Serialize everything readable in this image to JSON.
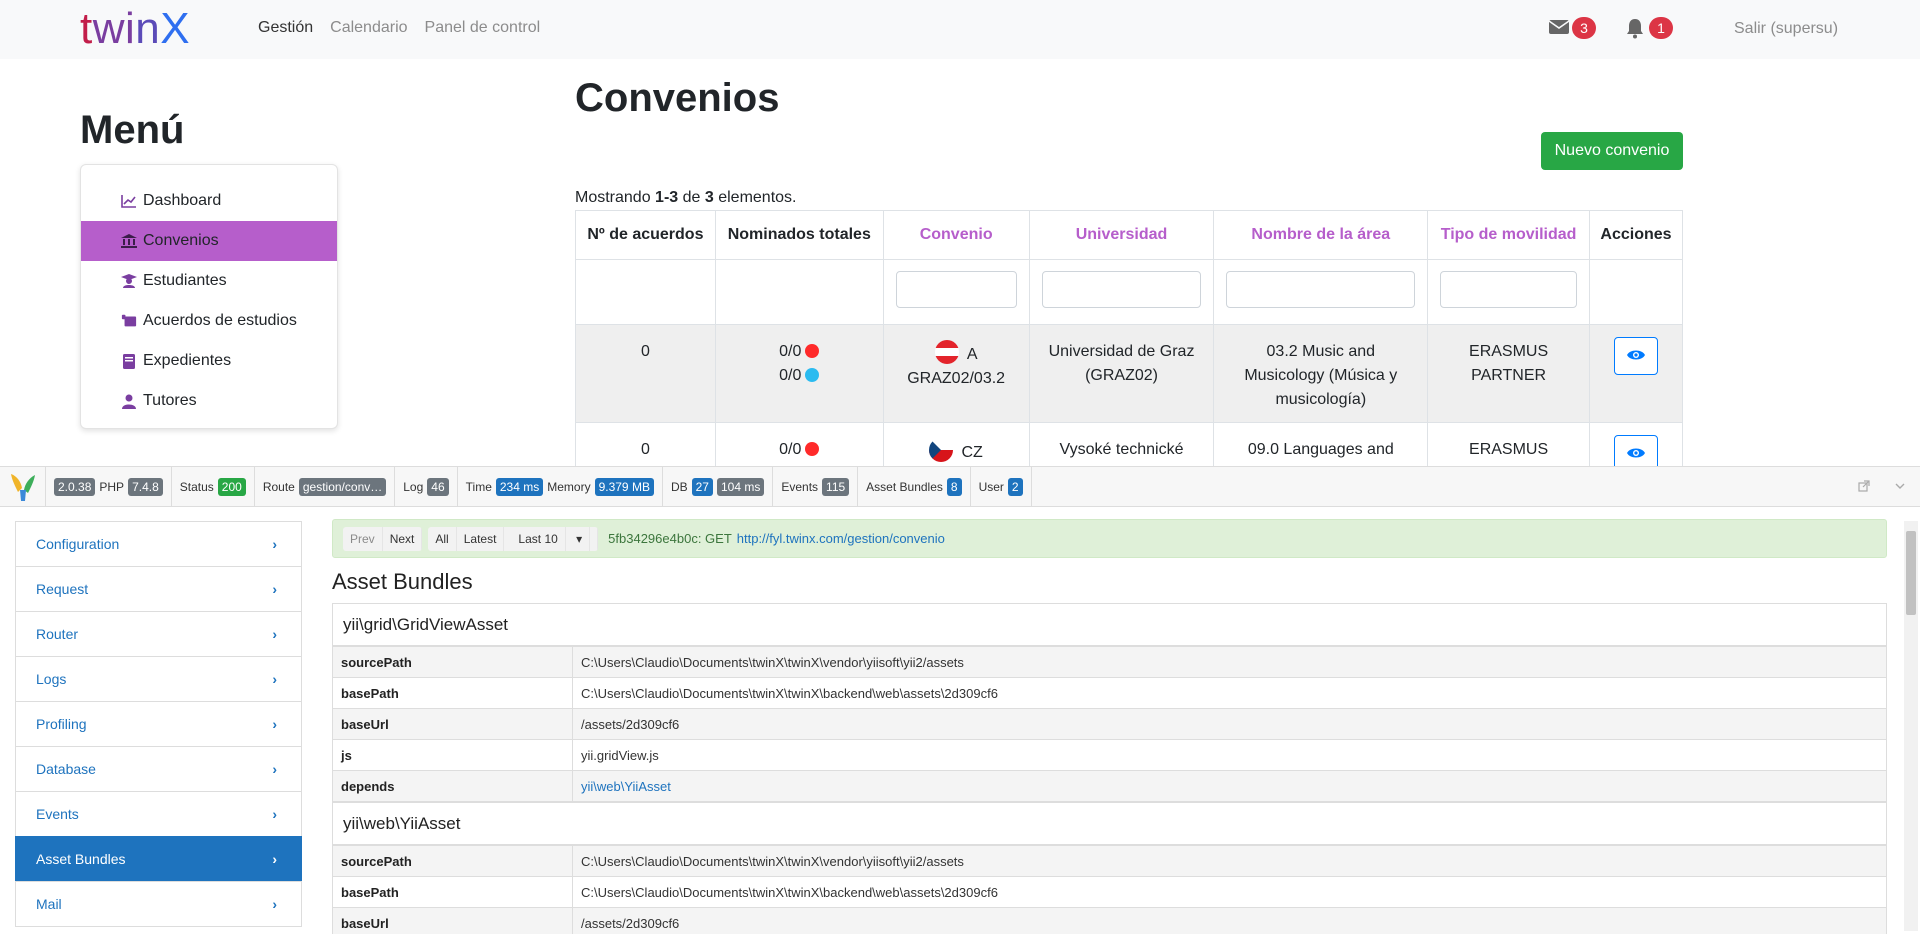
{
  "navbar": {
    "brand": [
      "t",
      "w",
      "i",
      "n",
      "X"
    ],
    "links": [
      "Gestión",
      "Calendario",
      "Panel de control"
    ],
    "messages_count": "3",
    "notifications_count": "1",
    "logout": "Salir (supersu)"
  },
  "menu": {
    "title": "Menú",
    "items": [
      {
        "label": "Dashboard",
        "icon": "chart-line-icon"
      },
      {
        "label": "Convenios",
        "icon": "landmark-icon"
      },
      {
        "label": "Estudiantes",
        "icon": "graduate-icon"
      },
      {
        "label": "Acuerdos de estudios",
        "icon": "scroll-icon"
      },
      {
        "label": "Expedientes",
        "icon": "book-icon"
      },
      {
        "label": "Tutores",
        "icon": "tutor-icon"
      }
    ],
    "active": "Convenios"
  },
  "main": {
    "title": "Convenios",
    "new_button": "Nuevo convenio",
    "summary": {
      "prefix": "Mostrando ",
      "range": "1-3",
      "mid": " de ",
      "total": "3",
      "suffix": " elementos."
    },
    "columns": [
      "Nº de acuerdos",
      "Nominados totales",
      "Convenio",
      "Universidad",
      "Nombre de la área",
      "Tipo de movilidad",
      "Acciones"
    ],
    "rows": [
      {
        "acuerdos": "0",
        "nominados_1": "0/0",
        "nominados_2": "0/0",
        "flag": "austria",
        "convenio_1": "A",
        "convenio_2": "GRAZ02/03.2",
        "universidad_1": "Universidad de Graz",
        "universidad_2": "(GRAZ02)",
        "area_1": "03.2 Music and",
        "area_2": "Musicology (Música y",
        "area_3": "musicología)",
        "movilidad_1": "ERASMUS",
        "movilidad_2": "PARTNER"
      },
      {
        "acuerdos": "0",
        "nominados_1": "0/0",
        "flag": "czech",
        "convenio_1": "CZ",
        "universidad_1": "Vysoké technické",
        "area_1": "09.0 Languages and",
        "movilidad_1": "ERASMUS"
      }
    ]
  },
  "debug": {
    "version": "2.0.38",
    "php_label": "PHP",
    "php_version": "7.4.8",
    "status_label": "Status",
    "status": "200",
    "route_label": "Route",
    "route": "gestion/conv…",
    "log_label": "Log",
    "log": "46",
    "time_label": "Time",
    "time": "234 ms",
    "memory_label": "Memory",
    "memory": "9.379 MB",
    "db_label": "DB",
    "db_queries": "27",
    "db_time": "104 ms",
    "events_label": "Events",
    "events": "115",
    "assets_label": "Asset Bundles",
    "assets": "8",
    "user_label": "User",
    "user": "2",
    "sidebar": [
      "Configuration",
      "Request",
      "Router",
      "Logs",
      "Profiling",
      "Database",
      "Events",
      "Asset Bundles",
      "Mail"
    ],
    "sidebar_active": "Asset Bundles",
    "nav_buttons": {
      "prev": "Prev",
      "next": "Next",
      "all": "All",
      "latest": "Latest",
      "last": "Last 10"
    },
    "request_id": "5fb34296e4b0c: GET",
    "request_url": "http://fyl.twinx.com/gestion/convenio",
    "panel_title": "Asset Bundles",
    "bundles": [
      {
        "name": "yii\\grid\\GridViewAsset",
        "rows": [
          {
            "k": "sourcePath",
            "v": "C:\\Users\\Claudio\\Documents\\twinX\\twinX\\vendor\\yiisoft\\yii2/assets"
          },
          {
            "k": "basePath",
            "v": "C:\\Users\\Claudio\\Documents\\twinX\\twinX\\backend\\web\\assets\\2d309cf6"
          },
          {
            "k": "baseUrl",
            "v": "/assets/2d309cf6"
          },
          {
            "k": "js",
            "v": "yii.gridView.js"
          },
          {
            "k": "depends",
            "v": "yii\\web\\YiiAsset"
          }
        ]
      },
      {
        "name": "yii\\web\\YiiAsset",
        "rows": [
          {
            "k": "sourcePath",
            "v": "C:\\Users\\Claudio\\Documents\\twinX\\twinX\\vendor\\yiisoft\\yii2/assets"
          },
          {
            "k": "basePath",
            "v": "C:\\Users\\Claudio\\Documents\\twinX\\twinX\\backend\\web\\assets\\2d309cf6"
          },
          {
            "k": "baseUrl",
            "v": "/assets/2d309cf6"
          }
        ]
      }
    ]
  },
  "colors": {
    "accent": "#b65ecb",
    "success": "#28a745",
    "debug_blue": "#1e73be",
    "badge_red": "#dc3545"
  }
}
